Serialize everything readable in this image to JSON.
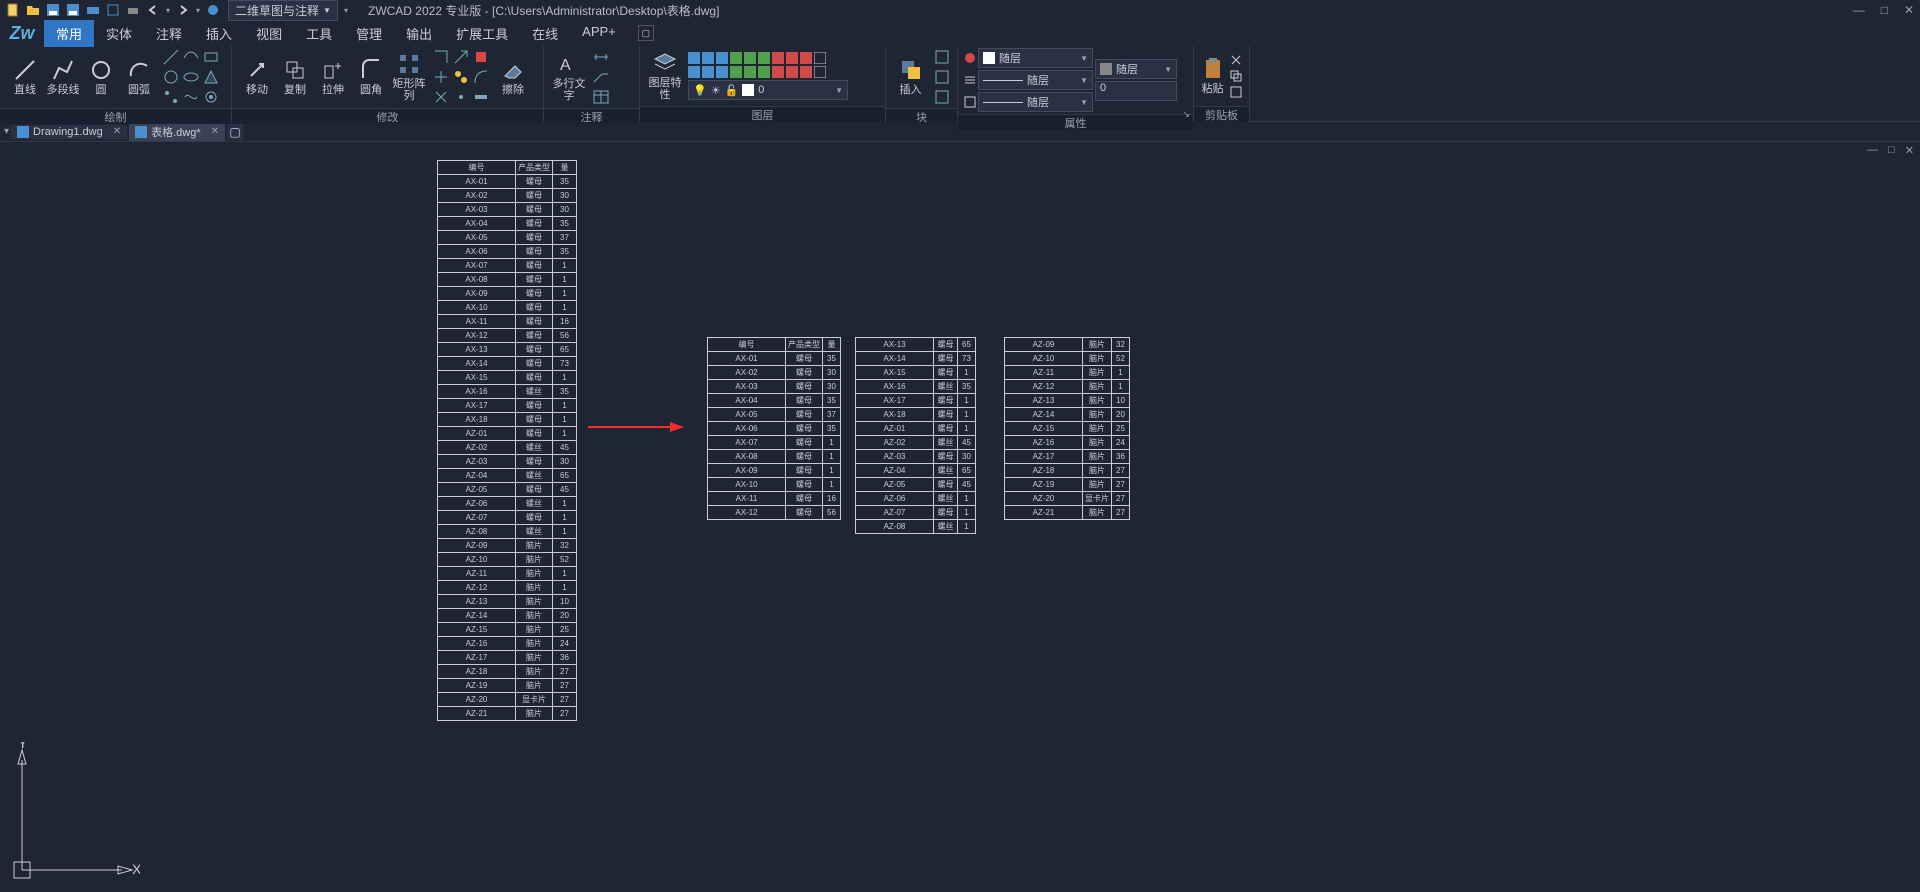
{
  "titlebar": {
    "workspace": "二维草图与注释",
    "app_title": "ZWCAD 2022 专业版 - [C:\\Users\\Administrator\\Desktop\\表格.dwg]"
  },
  "tabs": [
    "常用",
    "实体",
    "注释",
    "插入",
    "视图",
    "工具",
    "管理",
    "输出",
    "扩展工具",
    "在线",
    "APP+"
  ],
  "panels": {
    "draw": {
      "label": "绘制",
      "btns": [
        {
          "l": "直线"
        },
        {
          "l": "多段线"
        },
        {
          "l": "圆"
        },
        {
          "l": "圆弧"
        }
      ]
    },
    "modify": {
      "label": "修改",
      "btns": [
        {
          "l": "移动"
        },
        {
          "l": "复制"
        },
        {
          "l": "拉伸"
        },
        {
          "l": "圆角"
        },
        {
          "l": "矩形阵列"
        },
        {
          "l": "擦除"
        }
      ]
    },
    "annot": {
      "label": "注释",
      "btns": [
        {
          "l": "多行文字"
        }
      ]
    },
    "layer": {
      "label": "图层",
      "btn": "图层特性",
      "current": "0"
    },
    "block": {
      "label": "块",
      "btn": "插入"
    },
    "prop": {
      "label": "属性",
      "bylayer": "随层",
      "input": "0"
    },
    "clip": {
      "label": "剪贴板",
      "btn": "粘贴"
    }
  },
  "doc_tabs": [
    {
      "name": "Drawing1.dwg",
      "active": false
    },
    {
      "name": "表格.dwg*",
      "active": true
    }
  ],
  "table_header": [
    "编号",
    "产品类型",
    "量"
  ],
  "table_main": [
    [
      "AX-01",
      "螺母",
      "35"
    ],
    [
      "AX-02",
      "螺母",
      "30"
    ],
    [
      "AX-03",
      "螺母",
      "30"
    ],
    [
      "AX-04",
      "螺母",
      "35"
    ],
    [
      "AX-05",
      "螺母",
      "37"
    ],
    [
      "AX-06",
      "螺母",
      "35"
    ],
    [
      "AX-07",
      "螺母",
      "1"
    ],
    [
      "AX-08",
      "螺母",
      "1"
    ],
    [
      "AX-09",
      "螺母",
      "1"
    ],
    [
      "AX-10",
      "螺母",
      "1"
    ],
    [
      "AX-11",
      "螺母",
      "16"
    ],
    [
      "AX-12",
      "螺母",
      "56"
    ],
    [
      "AX-13",
      "螺母",
      "65"
    ],
    [
      "AX-14",
      "螺母",
      "73"
    ],
    [
      "AX-15",
      "螺母",
      "1"
    ],
    [
      "AX-16",
      "螺丝",
      "35"
    ],
    [
      "AX-17",
      "螺母",
      "1"
    ],
    [
      "AX-18",
      "螺母",
      "1"
    ],
    [
      "AZ-01",
      "螺母",
      "1"
    ],
    [
      "AZ-02",
      "螺丝",
      "45"
    ],
    [
      "AZ-03",
      "螺母",
      "30"
    ],
    [
      "AZ-04",
      "螺丝",
      "65"
    ],
    [
      "AZ-05",
      "螺母",
      "45"
    ],
    [
      "AZ-06",
      "螺丝",
      "1"
    ],
    [
      "AZ-07",
      "螺母",
      "1"
    ],
    [
      "AZ-08",
      "螺丝",
      "1"
    ],
    [
      "AZ-09",
      "脑片",
      "32"
    ],
    [
      "AZ-10",
      "脑片",
      "52"
    ],
    [
      "AZ-11",
      "脑片",
      "1"
    ],
    [
      "AZ-12",
      "脑片",
      "1"
    ],
    [
      "AZ-13",
      "脑片",
      "10"
    ],
    [
      "AZ-14",
      "脑片",
      "20"
    ],
    [
      "AZ-15",
      "脑片",
      "25"
    ],
    [
      "AZ-16",
      "脑片",
      "24"
    ],
    [
      "AZ-17",
      "脑片",
      "36"
    ],
    [
      "AZ-18",
      "脑片",
      "27"
    ],
    [
      "AZ-19",
      "脑片",
      "27"
    ],
    [
      "AZ-20",
      "显卡片",
      "27"
    ],
    [
      "AZ-21",
      "脑片",
      "27"
    ]
  ],
  "table_split_1": [
    [
      "编号",
      "产品类型",
      "量"
    ],
    [
      "AX-01",
      "螺母",
      "35"
    ],
    [
      "AX-02",
      "螺母",
      "30"
    ],
    [
      "AX-03",
      "螺母",
      "30"
    ],
    [
      "AX-04",
      "螺母",
      "35"
    ],
    [
      "AX-05",
      "螺母",
      "37"
    ],
    [
      "AX-06",
      "螺母",
      "35"
    ],
    [
      "AX-07",
      "螺母",
      "1"
    ],
    [
      "AX-08",
      "螺母",
      "1"
    ],
    [
      "AX-09",
      "螺母",
      "1"
    ],
    [
      "AX-10",
      "螺母",
      "1"
    ],
    [
      "AX-11",
      "螺母",
      "16"
    ],
    [
      "AX-12",
      "螺母",
      "56"
    ]
  ],
  "table_split_2": [
    [
      "AX-13",
      "螺母",
      "65"
    ],
    [
      "AX-14",
      "螺母",
      "73"
    ],
    [
      "AX-15",
      "螺母",
      "1"
    ],
    [
      "AX-16",
      "螺丝",
      "35"
    ],
    [
      "AX-17",
      "螺母",
      "1"
    ],
    [
      "AX-18",
      "螺母",
      "1"
    ],
    [
      "AZ-01",
      "螺母",
      "1"
    ],
    [
      "AZ-02",
      "螺丝",
      "45"
    ],
    [
      "AZ-03",
      "螺母",
      "30"
    ],
    [
      "AZ-04",
      "螺丝",
      "65"
    ],
    [
      "AZ-05",
      "螺母",
      "45"
    ],
    [
      "AZ-06",
      "螺丝",
      "1"
    ],
    [
      "AZ-07",
      "螺母",
      "1"
    ],
    [
      "AZ-08",
      "螺丝",
      "1"
    ]
  ],
  "table_split_3": [
    [
      "AZ-09",
      "脑片",
      "32"
    ],
    [
      "AZ-10",
      "脑片",
      "52"
    ],
    [
      "AZ-11",
      "脑片",
      "1"
    ],
    [
      "AZ-12",
      "脑片",
      "1"
    ],
    [
      "AZ-13",
      "脑片",
      "10"
    ],
    [
      "AZ-14",
      "脑片",
      "20"
    ],
    [
      "AZ-15",
      "脑片",
      "25"
    ],
    [
      "AZ-16",
      "脑片",
      "24"
    ],
    [
      "AZ-17",
      "脑片",
      "36"
    ],
    [
      "AZ-18",
      "脑片",
      "27"
    ],
    [
      "AZ-19",
      "脑片",
      "27"
    ],
    [
      "AZ-20",
      "显卡片",
      "27"
    ],
    [
      "AZ-21",
      "脑片",
      "27"
    ]
  ],
  "ucs": {
    "x": "X",
    "y": "Y"
  }
}
